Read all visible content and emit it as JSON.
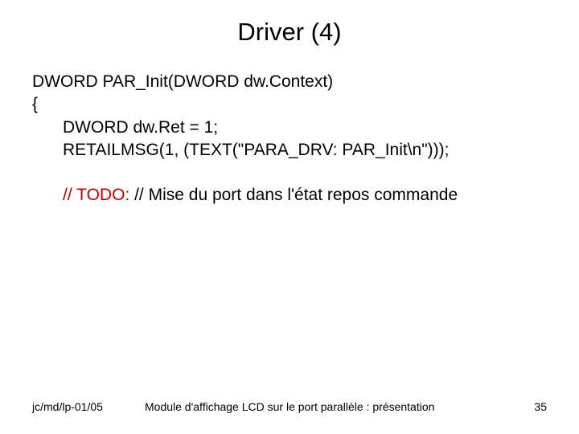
{
  "title": "Driver (4)",
  "code": {
    "line1": "DWORD PAR_Init(DWORD dw.Context)",
    "line2": "{",
    "line3": "DWORD dw.Ret = 1;",
    "line4": "RETAILMSG(1, (TEXT(\"PARA_DRV: PAR_Init\\n\")));",
    "todo_keyword": "// TODO:",
    "todo_rest": " // Mise du port dans l'état repos commande"
  },
  "footer": {
    "left": "jc/md/lp-01/05",
    "center": "Module d'affichage LCD sur le port parallèle : présentation",
    "right": "35"
  }
}
